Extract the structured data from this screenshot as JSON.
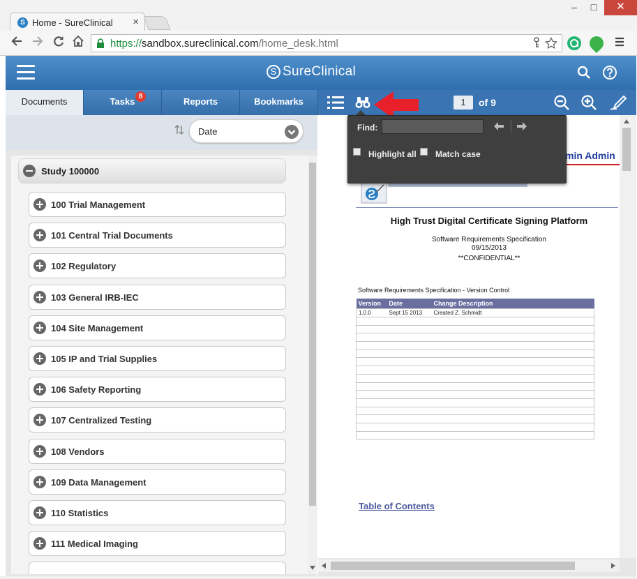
{
  "browser": {
    "tab_title": "Home - SureClinical",
    "tab_close": "×",
    "url_scheme": "https://",
    "url_host": "sandbox.sureclinical.com",
    "url_path": "/home_desk.html",
    "win_min": "–",
    "win_max": "□",
    "win_close": "✕"
  },
  "header": {
    "brand": "SureClinical",
    "brand_mark": "S"
  },
  "tabs": [
    {
      "label": "Documents",
      "active": true
    },
    {
      "label": "Tasks",
      "badge": "8"
    },
    {
      "label": "Reports"
    },
    {
      "label": "Bookmarks"
    }
  ],
  "viewer_toolbar": {
    "page_current": "1",
    "page_of": "of 9"
  },
  "sort": {
    "selected": "Date"
  },
  "tree": {
    "study": "Study 100000",
    "folders": [
      "100 Trial Management",
      "101 Central Trial Documents",
      "102 Regulatory",
      "103 General IRB-IEC",
      "104 Site Management",
      "105 IP and Trial Supplies",
      "106 Safety Reporting",
      "107 Centralized Testing",
      "108 Vendors",
      "109 Data Management",
      "110 Statistics",
      "111 Medical Imaging"
    ]
  },
  "find": {
    "label": "Find:",
    "value": "",
    "highlight_all": "Highlight all",
    "match_case": "Match case"
  },
  "document": {
    "admin_text": "min Admin",
    "title": "High Trust Digital Certificate Signing Platform",
    "subtitle": "Software Requirements Specification",
    "date": "09/15/2013",
    "confidential": "**CONFIDENTIAL**",
    "version_control_caption": "Software Requirements Specification - Version Control",
    "table_headers": [
      "Version",
      "Date",
      "Change Description"
    ],
    "table_rows": [
      [
        "1.0.0",
        "Sept 15 2013",
        "Created Z. Schmidt"
      ]
    ],
    "toc_link": "Table of Contents"
  },
  "colors": {
    "header_blue": "#3a74b3",
    "badge_red": "#e53b2f",
    "annotation_arrow": "#e8202a"
  }
}
